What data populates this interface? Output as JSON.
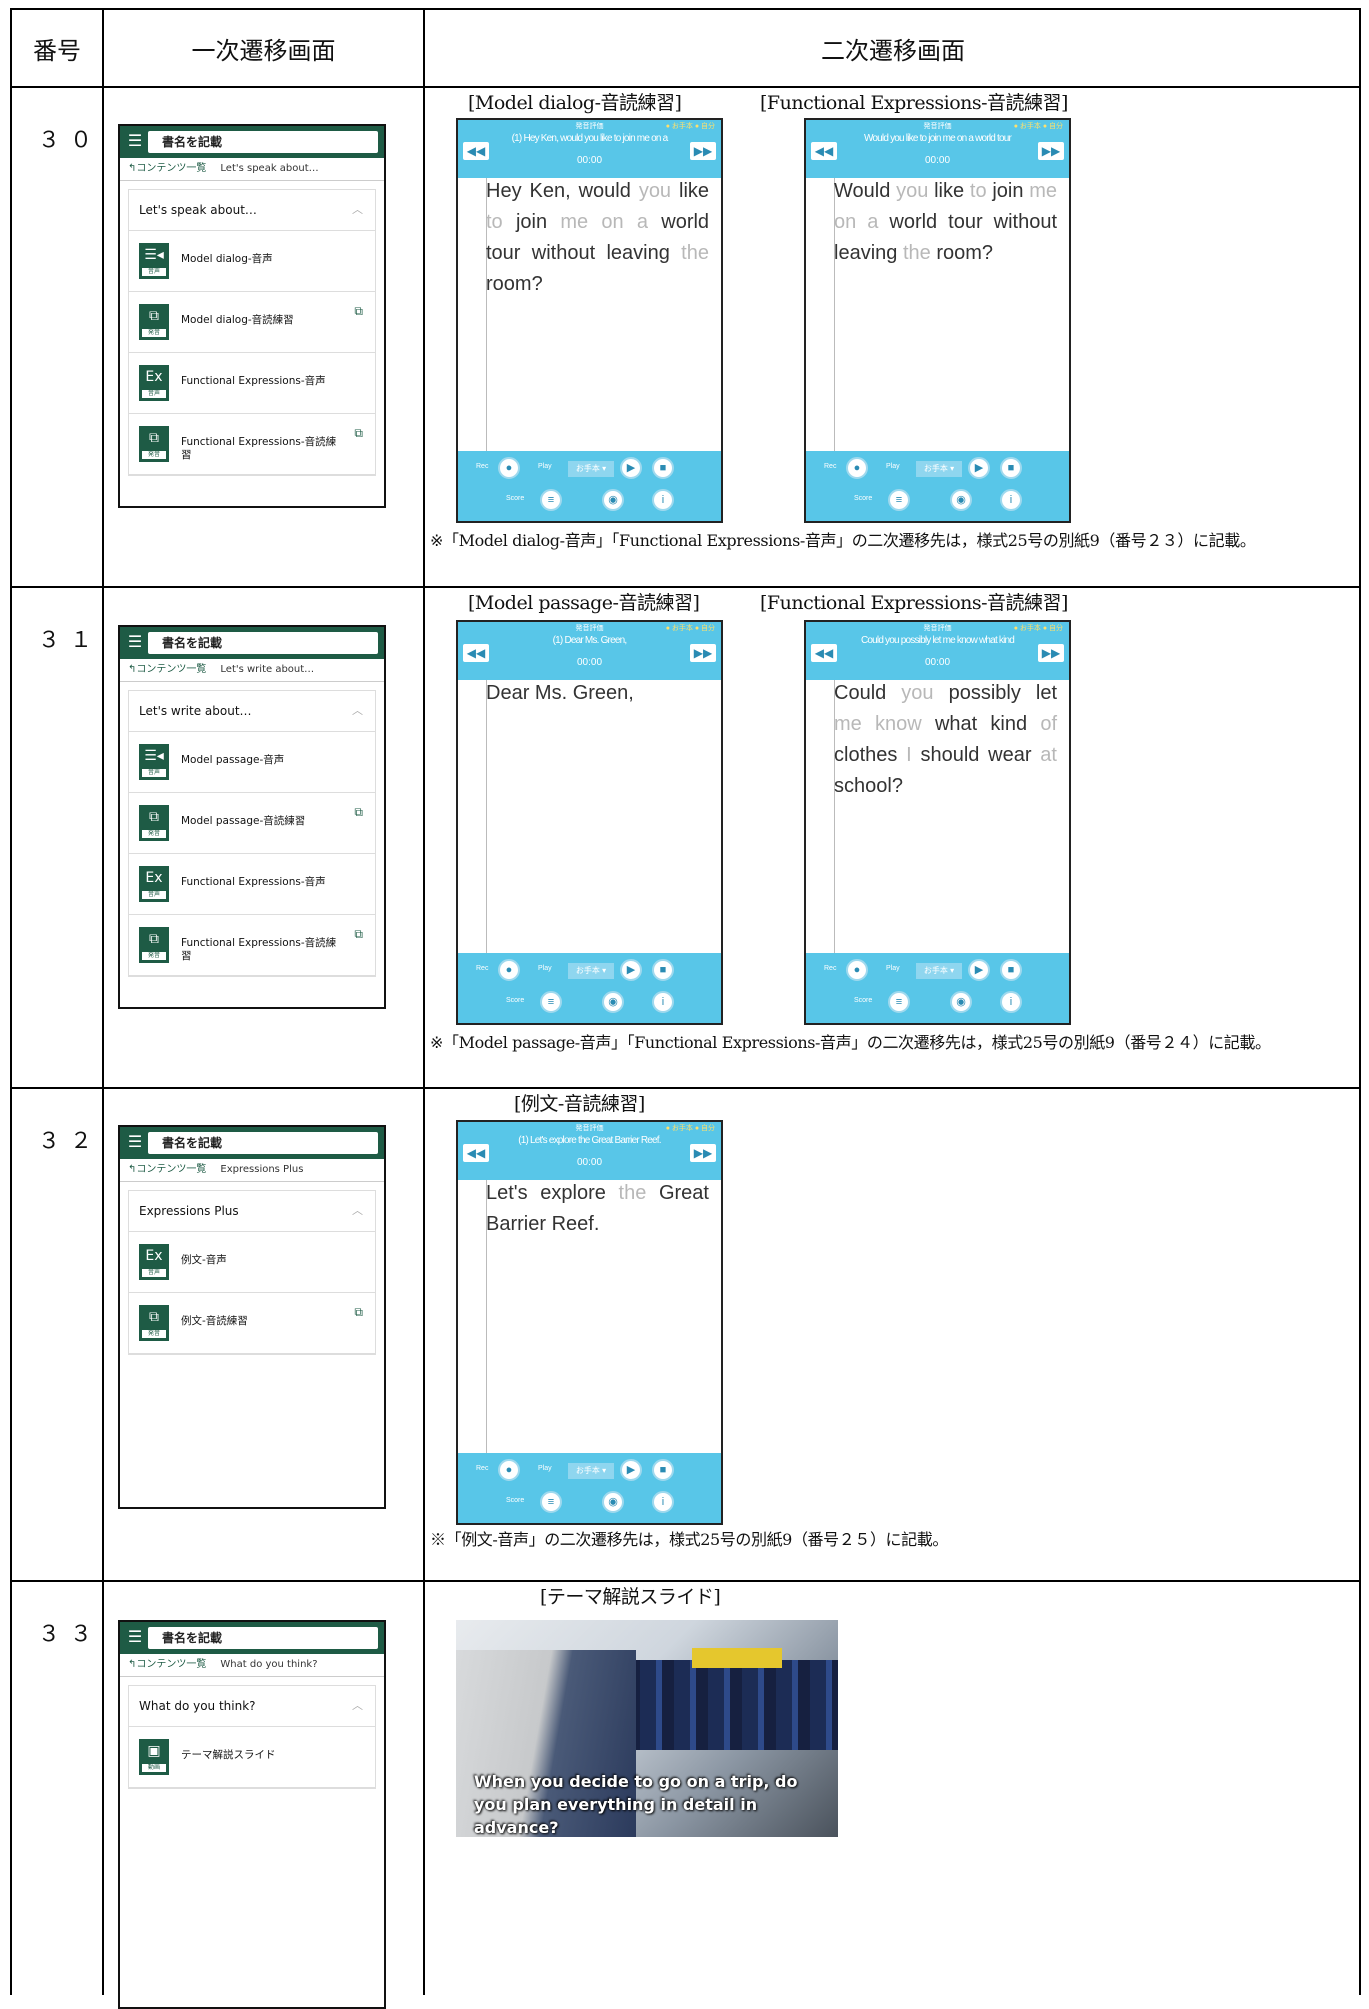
{
  "header": {
    "number": "番号",
    "primary": "一次遷移画面",
    "secondary": "二次遷移画面"
  },
  "rows": [
    {
      "number": "３０",
      "phone": {
        "title": "書名を記載",
        "back": "↰コンテンツ一覧",
        "crumb": "Let's speak about…",
        "section": "Let's speak about…",
        "items": [
          {
            "icon": "speaker-icon",
            "glyph": "☰◂",
            "tag": "音声",
            "label": "Model dialog-音声",
            "external": false
          },
          {
            "icon": "external-window-icon",
            "glyph": "⧉",
            "tag": "発音",
            "label": "Model dialog-音読練習",
            "external": true
          },
          {
            "icon": "expression-audio-icon",
            "glyph": "Ex",
            "tag": "音声",
            "label": "Functional Expressions-音声",
            "external": false
          },
          {
            "icon": "external-window-icon",
            "glyph": "⧉",
            "tag": "発音",
            "label": "Functional Expressions-音読練習",
            "external": true
          }
        ]
      },
      "screens": [
        {
          "caption": "[Model dialog-音読練習]",
          "sentence": "(1) Hey Ken, would you like to join me on a",
          "time": "00:00",
          "words": [
            [
              "Hey",
              0
            ],
            [
              "Ken,",
              0
            ],
            [
              "would",
              0
            ],
            [
              "you",
              1
            ],
            [
              "like",
              0
            ],
            [
              "to",
              1
            ],
            [
              "join",
              0
            ],
            [
              "me",
              1
            ],
            [
              "on",
              1
            ],
            [
              "a",
              1
            ],
            [
              "world",
              0
            ],
            [
              "tour",
              0
            ],
            [
              "without",
              0
            ],
            [
              "leaving",
              0
            ],
            [
              "the",
              1
            ],
            [
              "room?",
              0
            ]
          ]
        },
        {
          "caption": "[Functional Expressions-音読練習]",
          "sentence": "Would you like to join me on a world tour",
          "time": "00:00",
          "words": [
            [
              "Would",
              0
            ],
            [
              "you",
              1
            ],
            [
              "like",
              0
            ],
            [
              "to",
              1
            ],
            [
              "join",
              0
            ],
            [
              "me",
              1
            ],
            [
              "on",
              1
            ],
            [
              "a",
              1
            ],
            [
              "world",
              0
            ],
            [
              "tour",
              0
            ],
            [
              "without",
              0
            ],
            [
              "leaving",
              0
            ],
            [
              "the",
              1
            ],
            [
              "room?",
              0
            ]
          ]
        }
      ],
      "note": "※「Model dialog-音声」「Functional Expressions-音声」の二次遷移先は，様式25号の別紙9（番号２３）に記載。"
    },
    {
      "number": "３１",
      "phone": {
        "title": "書名を記載",
        "back": "↰コンテンツ一覧",
        "crumb": "Let's write about…",
        "section": "Let's write about…",
        "items": [
          {
            "icon": "speaker-icon",
            "glyph": "☰◂",
            "tag": "音声",
            "label": "Model passage-音声",
            "external": false
          },
          {
            "icon": "external-window-icon",
            "glyph": "⧉",
            "tag": "発音",
            "label": "Model passage-音読練習",
            "external": true
          },
          {
            "icon": "expression-audio-icon",
            "glyph": "Ex",
            "tag": "音声",
            "label": "Functional Expressions-音声",
            "external": false
          },
          {
            "icon": "external-window-icon",
            "glyph": "⧉",
            "tag": "発音",
            "label": "Functional Expressions-音読練習",
            "external": true
          }
        ]
      },
      "screens": [
        {
          "caption": "[Model passage-音読練習]",
          "sentence": "(1) Dear Ms. Green,",
          "time": "00:00",
          "words": [
            [
              "Dear",
              0
            ],
            [
              "Ms.",
              0
            ],
            [
              "Green,",
              0
            ]
          ]
        },
        {
          "caption": "[Functional Expressions-音読練習]",
          "sentence": "Could you possibly let me know what kind",
          "time": "00:00",
          "words": [
            [
              "Could",
              0
            ],
            [
              "you",
              1
            ],
            [
              "possibly",
              0
            ],
            [
              "let",
              0
            ],
            [
              "me",
              1
            ],
            [
              "know",
              1
            ],
            [
              "what",
              0
            ],
            [
              "kind",
              0
            ],
            [
              "of",
              1
            ],
            [
              "clothes",
              0
            ],
            [
              "I",
              1
            ],
            [
              "should",
              0
            ],
            [
              "wear",
              0
            ],
            [
              "at",
              1
            ],
            [
              "school?",
              0
            ]
          ]
        }
      ],
      "note": "※「Model passage-音声」「Functional Expressions-音声」の二次遷移先は，様式25号の別紙9（番号２４）に記載。"
    },
    {
      "number": "３２",
      "phone": {
        "title": "書名を記載",
        "back": "↰コンテンツ一覧",
        "crumb": "Expressions Plus",
        "section": "Expressions Plus",
        "items": [
          {
            "icon": "expression-audio-icon",
            "glyph": "Ex",
            "tag": "音声",
            "label": "例文-音声",
            "external": false
          },
          {
            "icon": "external-window-icon",
            "glyph": "⧉",
            "tag": "発音",
            "label": "例文-音読練習",
            "external": true
          }
        ]
      },
      "screens": [
        {
          "caption": "[例文-音読練習]",
          "sentence": "(1) Let's explore the Great Barrier Reef.",
          "time": "00:00",
          "words": [
            [
              "Let's",
              0
            ],
            [
              "explore",
              0
            ],
            [
              "the",
              1
            ],
            [
              "Great",
              0
            ],
            [
              "Barrier",
              0
            ],
            [
              "Reef.",
              0
            ]
          ]
        }
      ],
      "note": "※「例文-音声」の二次遷移先は，様式25号の別紙9（番号２５）に記載。"
    },
    {
      "number": "３３",
      "phone": {
        "title": "書名を記載",
        "back": "↰コンテンツ一覧",
        "crumb": "What do you think?",
        "section": "What do you think?",
        "items": [
          {
            "icon": "slides-icon",
            "glyph": "▣",
            "tag": "動画",
            "label": "テーマ解説スライド",
            "external": false
          }
        ]
      },
      "slide": {
        "caption": "[テーマ解説スライド]",
        "text": "When you decide to go on a trip, do you plan everything in detail in advance?"
      }
    }
  ],
  "app_ui": {
    "mini_title": "発音評価",
    "score": "● お手本  ● 自分",
    "rec": "Rec",
    "play": "Play",
    "select": "お手本 ▾",
    "score_label": "Score",
    "prev": "◀◀",
    "next": "▶▶",
    "play_icon": "▶",
    "stop_icon": "■",
    "info_icon": "i",
    "mic_icon": "●",
    "record_icon": "◉",
    "doc_icon": "≡"
  }
}
